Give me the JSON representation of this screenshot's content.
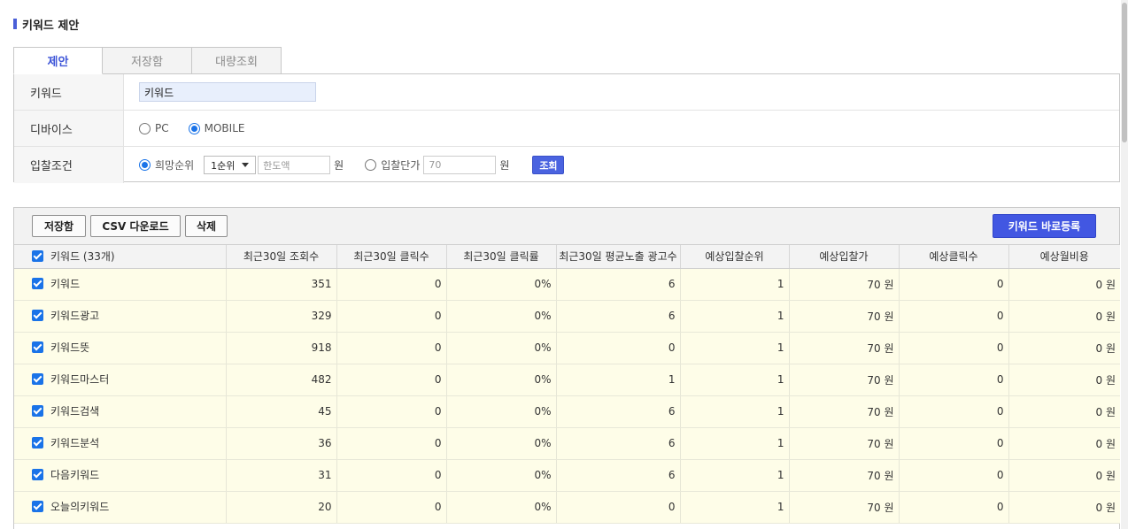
{
  "page": {
    "title": "키워드 제안"
  },
  "tabs": [
    {
      "label": "제안",
      "active": true
    },
    {
      "label": "저장함",
      "active": false
    },
    {
      "label": "대량조회",
      "active": false
    }
  ],
  "form": {
    "keyword": {
      "label": "키워드",
      "value": "키워드"
    },
    "device": {
      "label": "디바이스",
      "options": [
        "PC",
        "MOBILE"
      ],
      "selected": "MOBILE"
    },
    "bid": {
      "label": "입찰조건",
      "rank_option": "희망순위",
      "rank_select": "1순위",
      "limit_placeholder": "한도액",
      "unit1": "원",
      "price_option": "입찰단가",
      "price_value": "70",
      "unit2": "원",
      "search_button": "조회"
    }
  },
  "toolbar": {
    "save": "저장함",
    "csv": "CSV 다운로드",
    "delete": "삭제",
    "register": "키워드 바로등록"
  },
  "table": {
    "headers": [
      "키워드 (33개)",
      "최근30일 조회수",
      "최근30일 클릭수",
      "최근30일 클릭률",
      "최근30일 평균노출 광고수",
      "예상입찰순위",
      "예상입찰가",
      "예상클릭수",
      "예상월비용"
    ],
    "rows": [
      [
        "키워드",
        "351",
        "0",
        "0%",
        "6",
        "1",
        "70 원",
        "0",
        "0 원"
      ],
      [
        "키워드광고",
        "329",
        "0",
        "0%",
        "6",
        "1",
        "70 원",
        "0",
        "0 원"
      ],
      [
        "키워드뜻",
        "918",
        "0",
        "0%",
        "0",
        "1",
        "70 원",
        "0",
        "0 원"
      ],
      [
        "키워드마스터",
        "482",
        "0",
        "0%",
        "1",
        "1",
        "70 원",
        "0",
        "0 원"
      ],
      [
        "키워드검색",
        "45",
        "0",
        "0%",
        "6",
        "1",
        "70 원",
        "0",
        "0 원"
      ],
      [
        "키워드분석",
        "36",
        "0",
        "0%",
        "6",
        "1",
        "70 원",
        "0",
        "0 원"
      ],
      [
        "다음키워드",
        "31",
        "0",
        "0%",
        "6",
        "1",
        "70 원",
        "0",
        "0 원"
      ],
      [
        "오늘의키워드",
        "20",
        "0",
        "0%",
        "0",
        "1",
        "70 원",
        "0",
        "0 원"
      ]
    ]
  },
  "colors": {
    "accent": "#4257e2",
    "row_bg": "#fefde8",
    "header_bg": "#f3f3f3"
  }
}
